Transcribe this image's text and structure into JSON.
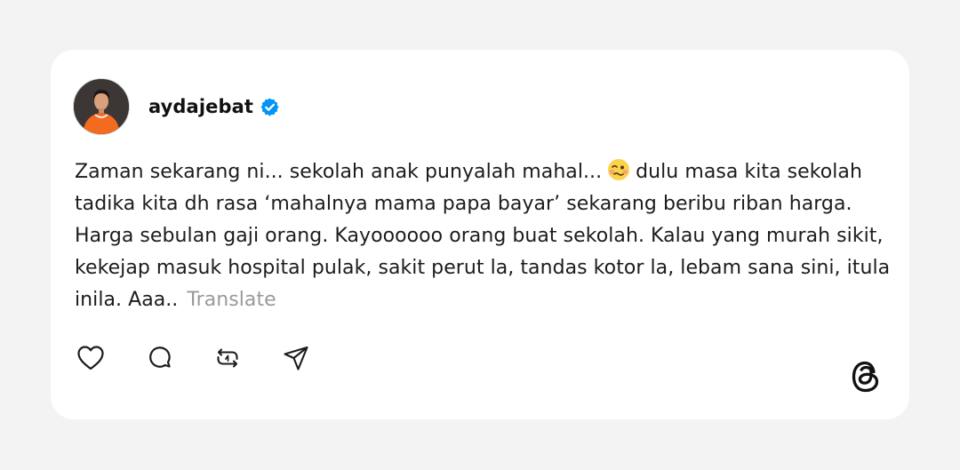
{
  "post": {
    "username": "aydajebat",
    "text_part1": "Zaman sekarang ni... sekolah anak punyalah mahal...",
    "emoji_name": "woozy-face-emoji",
    "text_part2": "dulu masa kita sekolah tadika kita dh rasa ‘mahalnya mama papa bayar’ sekarang beribu riban harga. Harga sebulan gaji orang. Kayoooooo orang buat sekolah. Kalau yang murah sikit, kekejap masuk hospital pulak, sakit perut la, tandas kotor la, lebam sana sini, itula inila. Aaa..",
    "translate_label": "Translate"
  },
  "actions": [
    {
      "icon": "heart-icon"
    },
    {
      "icon": "comment-icon"
    },
    {
      "icon": "repost-icon"
    },
    {
      "icon": "share-icon"
    }
  ],
  "branding": {
    "logo": "threads-logo-icon"
  },
  "colors": {
    "background": "#f3f3f3",
    "card": "#ffffff",
    "verified": "#0095f6",
    "text": "#1c1c1c",
    "muted": "#9a9a9a"
  }
}
